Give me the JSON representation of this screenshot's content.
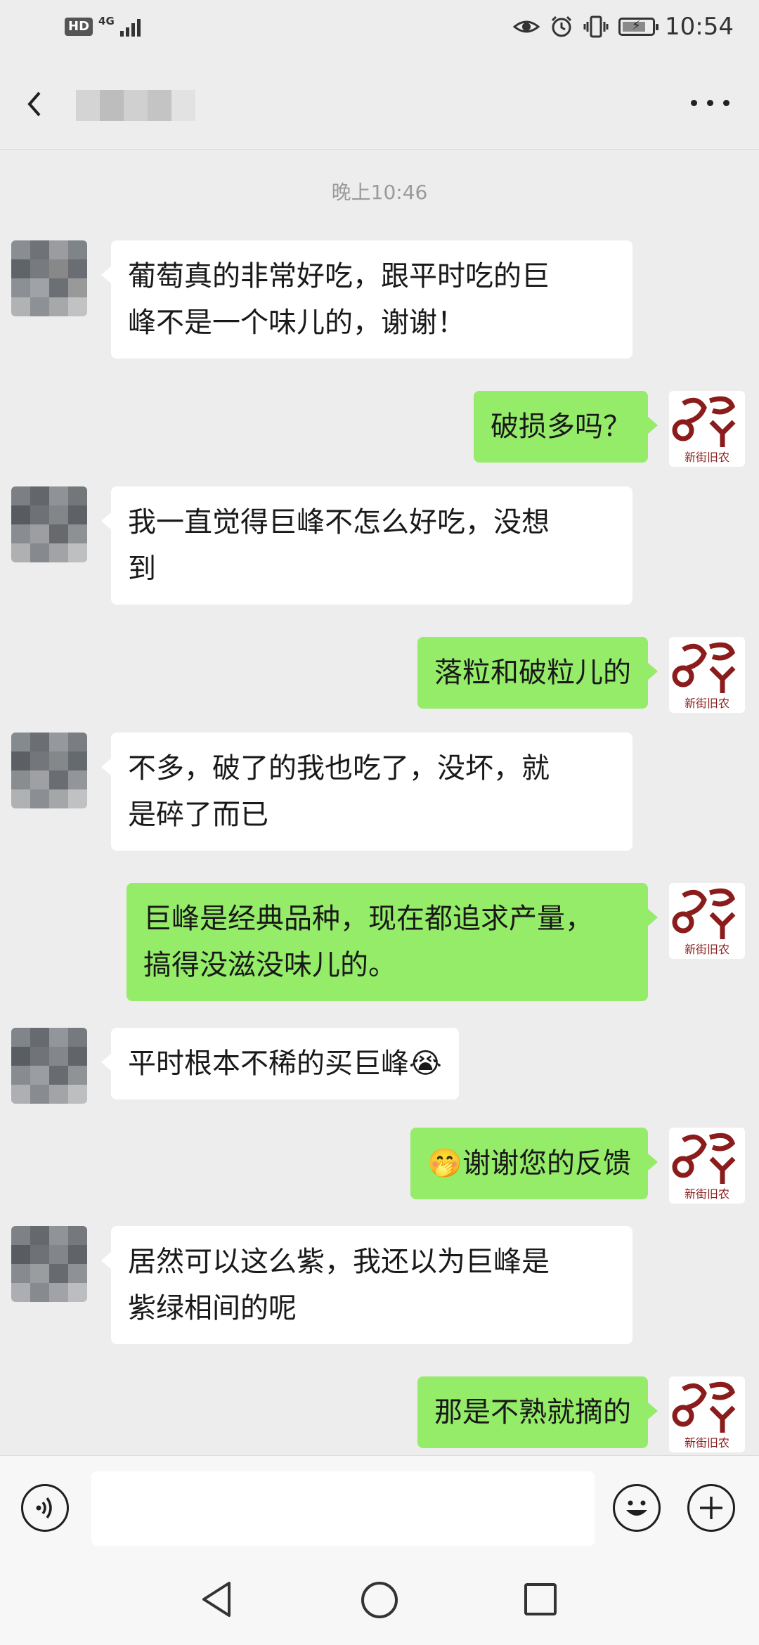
{
  "status_bar": {
    "hd_label": "HD",
    "network_label": "4G",
    "time": "10:54"
  },
  "header": {
    "back_icon": "chevron-left-icon",
    "more_icon": "ellipsis-icon"
  },
  "chat": {
    "timestamp": "晚上10:46",
    "messages": [
      {
        "side": "in",
        "lines": [
          "葡萄真的非常好吃，跟平时吃的巨",
          "峰不是一个味儿的，谢谢！"
        ]
      },
      {
        "side": "out",
        "lines": [
          "破损多吗？"
        ]
      },
      {
        "side": "in",
        "lines": [
          "我一直觉得巨峰不怎么好吃，没想",
          "到"
        ]
      },
      {
        "side": "out",
        "lines": [
          "落粒和破粒儿的"
        ]
      },
      {
        "side": "in",
        "lines": [
          "不多，破了的我也吃了，没坏，就",
          "是碎了而已"
        ]
      },
      {
        "side": "out",
        "lines": [
          "巨峰是经典品种，现在都追求产量，",
          "搞得没滋没味儿的。"
        ]
      },
      {
        "side": "in",
        "text": "平时根本不稀的买巨峰",
        "emoji": "😭"
      },
      {
        "side": "out",
        "emoji": "🤭",
        "text": "谢谢您的反馈"
      },
      {
        "side": "in",
        "lines": [
          "居然可以这么紫，我还以为巨峰是",
          "紫绿相间的呢"
        ]
      },
      {
        "side": "out",
        "lines": [
          "那是不熟就摘的"
        ]
      }
    ]
  },
  "store_avatar": {
    "caption": "新街旧农",
    "color": "#8b1c1c"
  },
  "colors": {
    "outgoing_bubble": "#95ec69",
    "incoming_bubble": "#ffffff",
    "background": "#ededed"
  },
  "input_bar": {
    "voice_icon": "voice-icon",
    "emoji_icon": "smiley-icon",
    "add_icon": "plus-icon"
  }
}
